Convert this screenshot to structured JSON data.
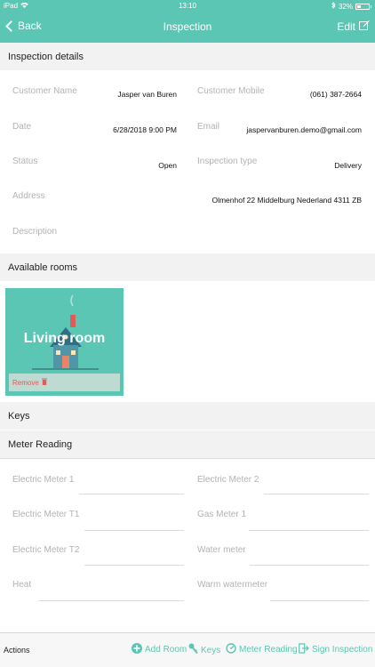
{
  "status_bar": {
    "carrier": "iPad",
    "time": "13:10",
    "battery": "32%"
  },
  "nav": {
    "back_label": "Back",
    "title": "Inspection",
    "edit_label": "Edit"
  },
  "inspection_details": {
    "header": "Inspection details",
    "customer_name_label": "Customer Name",
    "customer_name": "Jasper van Buren",
    "customer_mobile_label": "Customer Mobile",
    "customer_mobile": "(061) 387-2664",
    "date_label": "Date",
    "date": "6/28/2018 9:00 PM",
    "email_label": "Email",
    "email": "jaspervanburen.demo@gmail.com",
    "status_label": "Status",
    "status": "Open",
    "inspection_type_label": "Inspection type",
    "inspection_type": "Delivery",
    "address_label": "Address",
    "address": "Olmenhof 22 Middelburg Nederland 4311 ZB",
    "description_label": "Description"
  },
  "rooms": {
    "header": "Available rooms",
    "items": [
      {
        "name": "Living room",
        "remove_label": "Remove"
      }
    ]
  },
  "keys": {
    "header": "Keys"
  },
  "meter_reading": {
    "header": "Meter Reading",
    "fields": [
      "Electric Meter 1",
      "Electric Meter 2",
      "Electric Meter T1",
      "Gas Meter 1",
      "Electric Meter T2",
      "Water meter",
      "Heat",
      "Warm watermeter"
    ]
  },
  "toolbar": {
    "actions_label": "Actions",
    "add_room": "Add Room",
    "keys": "Keys",
    "meter_reading": "Meter Reading",
    "sign_inspection": "Sign Inspection"
  },
  "colors": {
    "accent": "#5bc6b3",
    "remove": "#e35b5b"
  }
}
